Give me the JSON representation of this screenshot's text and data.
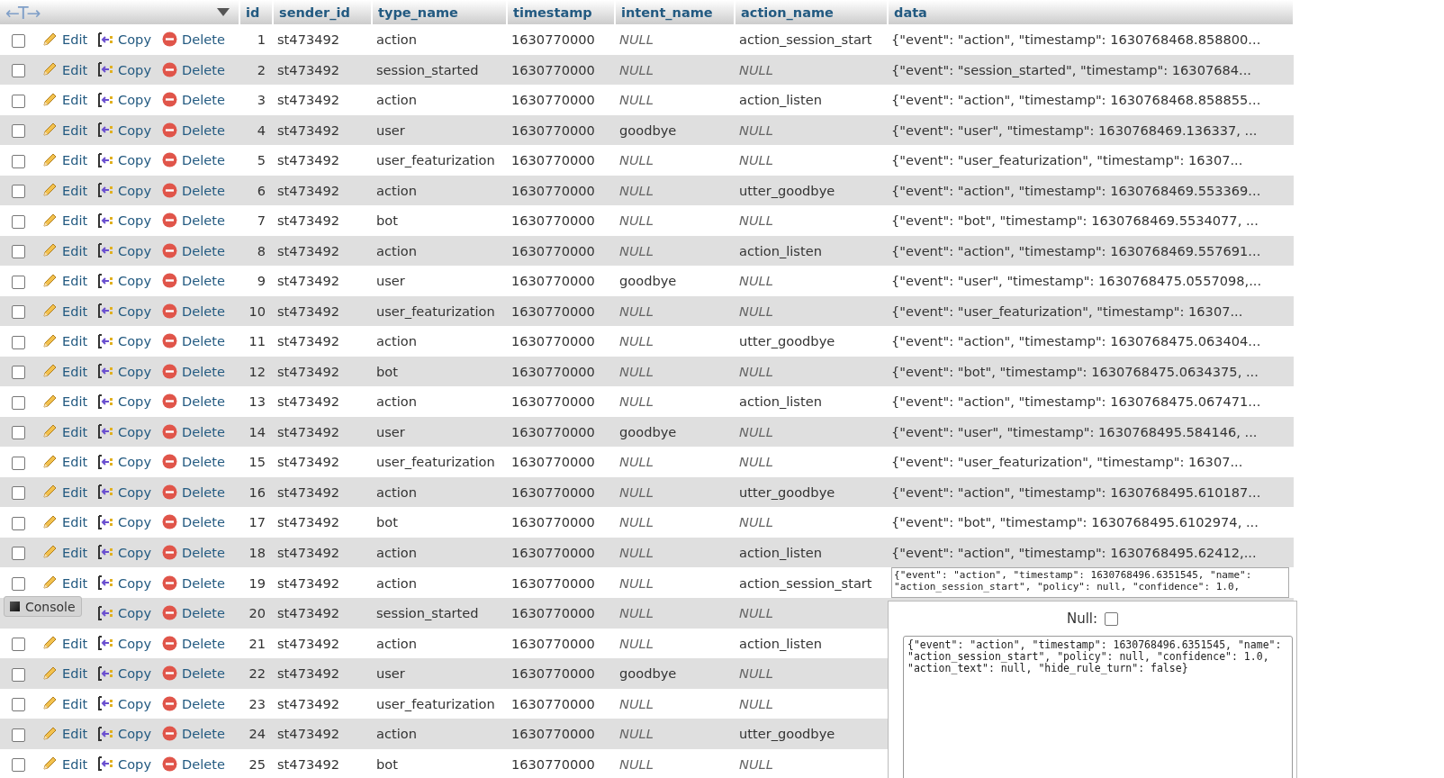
{
  "header": {
    "arrows": "←T→",
    "columns": [
      "id",
      "sender_id",
      "type_name",
      "timestamp",
      "intent_name",
      "action_name",
      "data"
    ]
  },
  "rows": [
    {
      "checked": false,
      "actions": [
        {
          "kind": "edit",
          "label": "Edit"
        },
        {
          "kind": "copy",
          "label": "Copy"
        },
        {
          "kind": "delete",
          "label": "Delete"
        }
      ],
      "id": "1",
      "sender_id": "st473492",
      "type_name": "action",
      "timestamp": "1630770000",
      "intent_name": "NULL",
      "intent_null": true,
      "action_name": "action_session_start",
      "action_null": false,
      "data": "{\"event\": \"action\", \"timestamp\": 1630768468.858800..."
    },
    {
      "checked": false,
      "actions": [
        {
          "kind": "edit",
          "label": "Edit"
        },
        {
          "kind": "copy",
          "label": "Copy"
        },
        {
          "kind": "delete",
          "label": "Delete"
        }
      ],
      "id": "2",
      "sender_id": "st473492",
      "type_name": "session_started",
      "timestamp": "1630770000",
      "intent_name": "NULL",
      "intent_null": true,
      "action_name": "NULL",
      "action_null": true,
      "data": "{\"event\": \"session_started\", \"timestamp\": 16307684..."
    },
    {
      "checked": false,
      "actions": [
        {
          "kind": "edit",
          "label": "Edit"
        },
        {
          "kind": "copy",
          "label": "Copy"
        },
        {
          "kind": "delete",
          "label": "Delete"
        }
      ],
      "id": "3",
      "sender_id": "st473492",
      "type_name": "action",
      "timestamp": "1630770000",
      "intent_name": "NULL",
      "intent_null": true,
      "action_name": "action_listen",
      "action_null": false,
      "data": "{\"event\": \"action\", \"timestamp\": 1630768468.858855..."
    },
    {
      "checked": false,
      "actions": [
        {
          "kind": "edit",
          "label": "Edit"
        },
        {
          "kind": "copy",
          "label": "Copy"
        },
        {
          "kind": "delete",
          "label": "Delete"
        }
      ],
      "id": "4",
      "sender_id": "st473492",
      "type_name": "user",
      "timestamp": "1630770000",
      "intent_name": "goodbye",
      "intent_null": false,
      "action_name": "NULL",
      "action_null": true,
      "data": "{\"event\": \"user\", \"timestamp\": 1630768469.136337, ..."
    },
    {
      "checked": false,
      "actions": [
        {
          "kind": "edit",
          "label": "Edit"
        },
        {
          "kind": "copy",
          "label": "Copy"
        },
        {
          "kind": "delete",
          "label": "Delete"
        }
      ],
      "id": "5",
      "sender_id": "st473492",
      "type_name": "user_featurization",
      "timestamp": "1630770000",
      "intent_name": "NULL",
      "intent_null": true,
      "action_name": "NULL",
      "action_null": true,
      "data": "{\"event\": \"user_featurization\", \"timestamp\": 16307..."
    },
    {
      "checked": false,
      "actions": [
        {
          "kind": "edit",
          "label": "Edit"
        },
        {
          "kind": "copy",
          "label": "Copy"
        },
        {
          "kind": "delete",
          "label": "Delete"
        }
      ],
      "id": "6",
      "sender_id": "st473492",
      "type_name": "action",
      "timestamp": "1630770000",
      "intent_name": "NULL",
      "intent_null": true,
      "action_name": "utter_goodbye",
      "action_null": false,
      "data": "{\"event\": \"action\", \"timestamp\": 1630768469.553369..."
    },
    {
      "checked": false,
      "actions": [
        {
          "kind": "edit",
          "label": "Edit"
        },
        {
          "kind": "copy",
          "label": "Copy"
        },
        {
          "kind": "delete",
          "label": "Delete"
        }
      ],
      "id": "7",
      "sender_id": "st473492",
      "type_name": "bot",
      "timestamp": "1630770000",
      "intent_name": "NULL",
      "intent_null": true,
      "action_name": "NULL",
      "action_null": true,
      "data": "{\"event\": \"bot\", \"timestamp\": 1630768469.5534077, ..."
    },
    {
      "checked": false,
      "actions": [
        {
          "kind": "edit",
          "label": "Edit"
        },
        {
          "kind": "copy",
          "label": "Copy"
        },
        {
          "kind": "delete",
          "label": "Delete"
        }
      ],
      "id": "8",
      "sender_id": "st473492",
      "type_name": "action",
      "timestamp": "1630770000",
      "intent_name": "NULL",
      "intent_null": true,
      "action_name": "action_listen",
      "action_null": false,
      "data": "{\"event\": \"action\", \"timestamp\": 1630768469.557691..."
    },
    {
      "checked": false,
      "actions": [
        {
          "kind": "edit",
          "label": "Edit"
        },
        {
          "kind": "copy",
          "label": "Copy"
        },
        {
          "kind": "delete",
          "label": "Delete"
        }
      ],
      "id": "9",
      "sender_id": "st473492",
      "type_name": "user",
      "timestamp": "1630770000",
      "intent_name": "goodbye",
      "intent_null": false,
      "action_name": "NULL",
      "action_null": true,
      "data": "{\"event\": \"user\", \"timestamp\": 1630768475.0557098,..."
    },
    {
      "checked": false,
      "actions": [
        {
          "kind": "edit",
          "label": "Edit"
        },
        {
          "kind": "copy",
          "label": "Copy"
        },
        {
          "kind": "delete",
          "label": "Delete"
        }
      ],
      "id": "10",
      "sender_id": "st473492",
      "type_name": "user_featurization",
      "timestamp": "1630770000",
      "intent_name": "NULL",
      "intent_null": true,
      "action_name": "NULL",
      "action_null": true,
      "data": "{\"event\": \"user_featurization\", \"timestamp\": 16307..."
    },
    {
      "checked": false,
      "actions": [
        {
          "kind": "edit",
          "label": "Edit"
        },
        {
          "kind": "copy",
          "label": "Copy"
        },
        {
          "kind": "delete",
          "label": "Delete"
        }
      ],
      "id": "11",
      "sender_id": "st473492",
      "type_name": "action",
      "timestamp": "1630770000",
      "intent_name": "NULL",
      "intent_null": true,
      "action_name": "utter_goodbye",
      "action_null": false,
      "data": "{\"event\": \"action\", \"timestamp\": 1630768475.063404..."
    },
    {
      "checked": false,
      "actions": [
        {
          "kind": "edit",
          "label": "Edit"
        },
        {
          "kind": "copy",
          "label": "Copy"
        },
        {
          "kind": "delete",
          "label": "Delete"
        }
      ],
      "id": "12",
      "sender_id": "st473492",
      "type_name": "bot",
      "timestamp": "1630770000",
      "intent_name": "NULL",
      "intent_null": true,
      "action_name": "NULL",
      "action_null": true,
      "data": "{\"event\": \"bot\", \"timestamp\": 1630768475.0634375, ..."
    },
    {
      "checked": false,
      "actions": [
        {
          "kind": "edit",
          "label": "Edit"
        },
        {
          "kind": "copy",
          "label": "Copy"
        },
        {
          "kind": "delete",
          "label": "Delete"
        }
      ],
      "id": "13",
      "sender_id": "st473492",
      "type_name": "action",
      "timestamp": "1630770000",
      "intent_name": "NULL",
      "intent_null": true,
      "action_name": "action_listen",
      "action_null": false,
      "data": "{\"event\": \"action\", \"timestamp\": 1630768475.067471..."
    },
    {
      "checked": false,
      "actions": [
        {
          "kind": "edit",
          "label": "Edit"
        },
        {
          "kind": "copy",
          "label": "Copy"
        },
        {
          "kind": "delete",
          "label": "Delete"
        }
      ],
      "id": "14",
      "sender_id": "st473492",
      "type_name": "user",
      "timestamp": "1630770000",
      "intent_name": "goodbye",
      "intent_null": false,
      "action_name": "NULL",
      "action_null": true,
      "data": "{\"event\": \"user\", \"timestamp\": 1630768495.584146, ..."
    },
    {
      "checked": false,
      "actions": [
        {
          "kind": "edit",
          "label": "Edit"
        },
        {
          "kind": "copy",
          "label": "Copy"
        },
        {
          "kind": "delete",
          "label": "Delete"
        }
      ],
      "id": "15",
      "sender_id": "st473492",
      "type_name": "user_featurization",
      "timestamp": "1630770000",
      "intent_name": "NULL",
      "intent_null": true,
      "action_name": "NULL",
      "action_null": true,
      "data": "{\"event\": \"user_featurization\", \"timestamp\": 16307..."
    },
    {
      "checked": false,
      "actions": [
        {
          "kind": "edit",
          "label": "Edit"
        },
        {
          "kind": "copy",
          "label": "Copy"
        },
        {
          "kind": "delete",
          "label": "Delete"
        }
      ],
      "id": "16",
      "sender_id": "st473492",
      "type_name": "action",
      "timestamp": "1630770000",
      "intent_name": "NULL",
      "intent_null": true,
      "action_name": "utter_goodbye",
      "action_null": false,
      "data": "{\"event\": \"action\", \"timestamp\": 1630768495.610187..."
    },
    {
      "checked": false,
      "actions": [
        {
          "kind": "edit",
          "label": "Edit"
        },
        {
          "kind": "copy",
          "label": "Copy"
        },
        {
          "kind": "delete",
          "label": "Delete"
        }
      ],
      "id": "17",
      "sender_id": "st473492",
      "type_name": "bot",
      "timestamp": "1630770000",
      "intent_name": "NULL",
      "intent_null": true,
      "action_name": "NULL",
      "action_null": true,
      "data": "{\"event\": \"bot\", \"timestamp\": 1630768495.6102974, ..."
    },
    {
      "checked": false,
      "actions": [
        {
          "kind": "edit",
          "label": "Edit"
        },
        {
          "kind": "copy",
          "label": "Copy"
        },
        {
          "kind": "delete",
          "label": "Delete"
        }
      ],
      "id": "18",
      "sender_id": "st473492",
      "type_name": "action",
      "timestamp": "1630770000",
      "intent_name": "NULL",
      "intent_null": true,
      "action_name": "action_listen",
      "action_null": false,
      "data": "{\"event\": \"action\", \"timestamp\": 1630768495.62412,..."
    },
    {
      "checked": false,
      "actions": [
        {
          "kind": "edit",
          "label": "Edit"
        },
        {
          "kind": "copy",
          "label": "Copy"
        },
        {
          "kind": "delete",
          "label": "Delete"
        }
      ],
      "id": "19",
      "sender_id": "st473492",
      "type_name": "action",
      "timestamp": "1630770000",
      "intent_name": "NULL",
      "intent_null": true,
      "action_name": "action_session_start",
      "action_null": false,
      "editor": "{\"event\": \"action\", \"timestamp\": 1630768496.6351545, \"name\": \"action_session_start\", \"policy\": null, \"confidence\": 1.0,"
    },
    {
      "actions": [
        {
          "kind": "copy",
          "label": "Copy"
        },
        {
          "kind": "delete",
          "label": "Delete"
        }
      ],
      "id": "20",
      "sender_id": "st473492",
      "type_name": "session_started",
      "timestamp": "1630770000",
      "intent_name": "NULL",
      "intent_null": true,
      "action_name": "NULL",
      "action_null": true
    },
    {
      "checked": false,
      "actions": [
        {
          "kind": "edit",
          "label": "Edit"
        },
        {
          "kind": "copy",
          "label": "Copy"
        },
        {
          "kind": "delete",
          "label": "Delete"
        }
      ],
      "id": "21",
      "sender_id": "st473492",
      "type_name": "action",
      "timestamp": "1630770000",
      "intent_name": "NULL",
      "intent_null": true,
      "action_name": "action_listen",
      "action_null": false
    },
    {
      "checked": false,
      "actions": [
        {
          "kind": "edit",
          "label": "Edit"
        },
        {
          "kind": "copy",
          "label": "Copy"
        },
        {
          "kind": "delete",
          "label": "Delete"
        }
      ],
      "id": "22",
      "sender_id": "st473492",
      "type_name": "user",
      "timestamp": "1630770000",
      "intent_name": "goodbye",
      "intent_null": false,
      "action_name": "NULL",
      "action_null": true
    },
    {
      "checked": false,
      "actions": [
        {
          "kind": "edit",
          "label": "Edit"
        },
        {
          "kind": "copy",
          "label": "Copy"
        },
        {
          "kind": "delete",
          "label": "Delete"
        }
      ],
      "id": "23",
      "sender_id": "st473492",
      "type_name": "user_featurization",
      "timestamp": "1630770000",
      "intent_name": "NULL",
      "intent_null": true,
      "action_name": "NULL",
      "action_null": true
    },
    {
      "checked": false,
      "actions": [
        {
          "kind": "edit",
          "label": "Edit"
        },
        {
          "kind": "copy",
          "label": "Copy"
        },
        {
          "kind": "delete",
          "label": "Delete"
        }
      ],
      "id": "24",
      "sender_id": "st473492",
      "type_name": "action",
      "timestamp": "1630770000",
      "intent_name": "NULL",
      "intent_null": true,
      "action_name": "utter_goodbye",
      "action_null": false
    },
    {
      "checked": false,
      "actions": [
        {
          "kind": "edit",
          "label": "Edit"
        },
        {
          "kind": "copy",
          "label": "Copy"
        },
        {
          "kind": "delete",
          "label": "Delete"
        }
      ],
      "id": "25",
      "sender_id": "st473492",
      "type_name": "bot",
      "timestamp": "1630770000",
      "intent_name": "NULL",
      "intent_null": true,
      "action_name": "NULL",
      "action_null": true
    }
  ],
  "popup": {
    "null_label": "Null:",
    "null_checked": false,
    "value": "{\"event\": \"action\", \"timestamp\": 1630768496.6351545, \"name\": \"action_session_start\", \"policy\": null, \"confidence\": 1.0, \"action_text\": null, \"hide_rule_turn\": false}"
  },
  "console": {
    "label": "Console"
  }
}
